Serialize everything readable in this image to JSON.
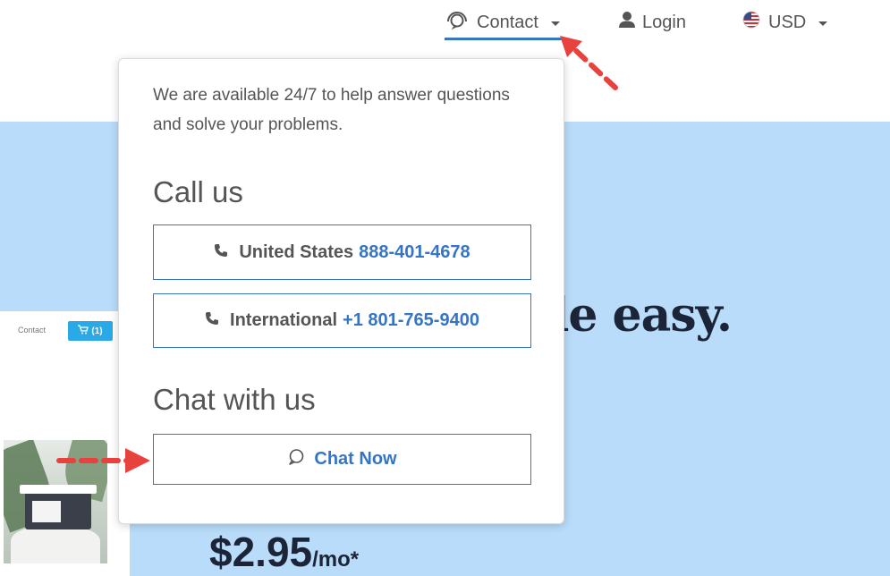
{
  "nav": {
    "contact_label": "Contact",
    "login_label": "Login",
    "currency_label": "USD",
    "accent_color": "#3575c5"
  },
  "hero": {
    "headline": "de easy.",
    "price_amount": "$2.95",
    "price_period": "/mo*",
    "background_color": "#b8dcfa"
  },
  "preview": {
    "contact_label": "Contact",
    "cart_label": "(1)"
  },
  "dropdown": {
    "intro": "We are available 24/7 to help answer questions and solve your problems.",
    "call_heading": "Call us",
    "phones": [
      {
        "country": "United States",
        "number": "888-401-4678"
      },
      {
        "country": "International",
        "number": "+1 801-765-9400"
      }
    ],
    "chat_heading": "Chat with us",
    "chat_button": "Chat Now"
  },
  "annotation_color": "#e8423f"
}
